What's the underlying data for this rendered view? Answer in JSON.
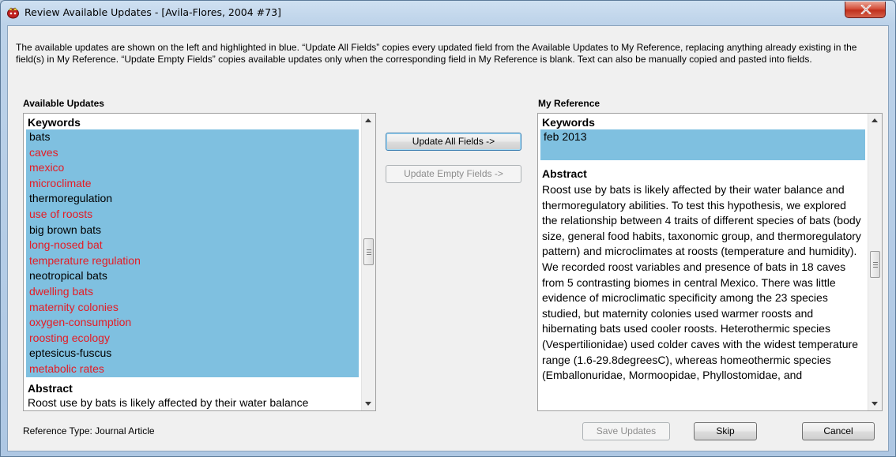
{
  "window": {
    "title": "Review Available Updates - [Avila-Flores, 2004 #73]"
  },
  "instructions": "The available updates are shown on the left and highlighted in blue. “Update All Fields” copies every updated field from the Available Updates to My Reference, replacing anything already existing in the field(s) in My Reference. “Update Empty Fields” copies available updates only when the corresponding field in My Reference is blank. Text can also be manually copied and pasted into fields.",
  "available_updates": {
    "label": "Available Updates",
    "keywords_heading": "Keywords",
    "keywords": [
      {
        "text": "bats",
        "is_update": false
      },
      {
        "text": "caves",
        "is_update": true
      },
      {
        "text": "mexico",
        "is_update": true
      },
      {
        "text": "microclimate",
        "is_update": true
      },
      {
        "text": "thermoregulation",
        "is_update": false
      },
      {
        "text": "use of roosts",
        "is_update": true
      },
      {
        "text": "big brown bats",
        "is_update": false
      },
      {
        "text": "long-nosed bat",
        "is_update": true
      },
      {
        "text": "temperature regulation",
        "is_update": true
      },
      {
        "text": "neotropical bats",
        "is_update": false
      },
      {
        "text": "dwelling bats",
        "is_update": true
      },
      {
        "text": "maternity colonies",
        "is_update": true
      },
      {
        "text": "oxygen-consumption",
        "is_update": true
      },
      {
        "text": "roosting ecology",
        "is_update": true
      },
      {
        "text": "eptesicus-fuscus",
        "is_update": false
      },
      {
        "text": "metabolic rates",
        "is_update": true
      }
    ],
    "abstract_heading": "Abstract",
    "abstract_partial": "Roost use by bats is likely affected by their water balance"
  },
  "my_reference": {
    "label": "My Reference",
    "keywords_heading": "Keywords",
    "keywords_value": "feb 2013",
    "abstract_heading": "Abstract",
    "abstract_text": "Roost use by bats is likely affected by their water balance and thermoregulatory abilities. To test this hypothesis, we explored the relationship between 4 traits of different species of bats (body size, general food habits, taxonomic group, and thermoregulatory pattern) and microclimates at roosts (temperature and humidity). We recorded roost variables and presence of bats in 18 caves from 5 contrasting biomes in central Mexico. There was little evidence of microclimatic specificity among the 23 species studied, but maternity colonies used warmer roosts and hibernating bats used cooler roosts. Heterothermic species (Vespertilionidae) used colder caves with the widest temperature range (1.6-29.8degreesC), whereas homeothermic species (Emballonuridae, Mormoopidae, Phyllostomidae, and"
  },
  "buttons": {
    "update_all": "Update All Fields ->",
    "update_empty": "Update Empty Fields ->",
    "save_updates": "Save Updates",
    "skip": "Skip",
    "cancel": "Cancel"
  },
  "reference_type": "Reference Type: Journal Article",
  "colors": {
    "highlight": "#7fc0e0",
    "update_text": "#e51b24"
  },
  "icons": [
    "endnote-app-icon",
    "close-icon",
    "scroll-up-icon",
    "scroll-down-icon",
    "scroll-thumb-grip-icon"
  ]
}
